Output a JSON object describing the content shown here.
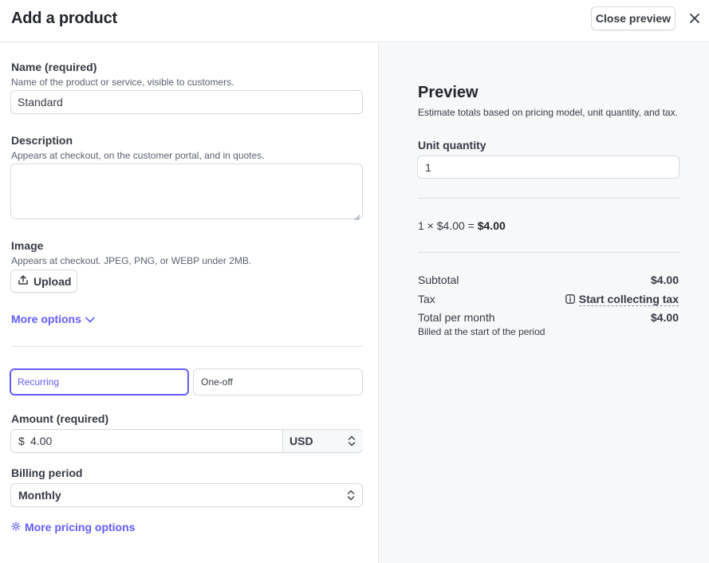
{
  "header": {
    "title": "Add a product",
    "close_preview_label": "Close preview"
  },
  "form": {
    "name": {
      "label": "Name (required)",
      "hint": "Name of the product or service, visible to customers.",
      "value": "Standard"
    },
    "description": {
      "label": "Description",
      "hint": "Appears at checkout, on the customer portal, and in quotes.",
      "value": ""
    },
    "image": {
      "label": "Image",
      "hint": "Appears at checkout. JPEG, PNG, or WEBP under 2MB.",
      "upload_label": "Upload"
    },
    "more_options_label": "More options",
    "pricing_type": {
      "options": [
        "Recurring",
        "One-off"
      ],
      "selected": "Recurring"
    },
    "amount": {
      "label": "Amount (required)",
      "prefix": "$",
      "value": "4.00",
      "currency": "USD"
    },
    "billing_period": {
      "label": "Billing period",
      "value": "Monthly"
    },
    "more_pricing_label": "More pricing options"
  },
  "preview": {
    "title": "Preview",
    "subtitle": "Estimate totals based on pricing model, unit quantity, and tax.",
    "unit_quantity": {
      "label": "Unit quantity",
      "value": "1"
    },
    "calculation": {
      "expression": "1 × $4.00 = ",
      "result": "$4.00"
    },
    "subtotal": {
      "label": "Subtotal",
      "value": "$4.00"
    },
    "tax": {
      "label": "Tax",
      "action": "Start collecting tax"
    },
    "total": {
      "label": "Total per month",
      "value": "$4.00",
      "note": "Billed at the start of the period"
    }
  },
  "colors": {
    "accent": "#635bff",
    "text": "#353a44",
    "border": "#d5dbe1",
    "panel_bg": "#f6f8fa"
  }
}
